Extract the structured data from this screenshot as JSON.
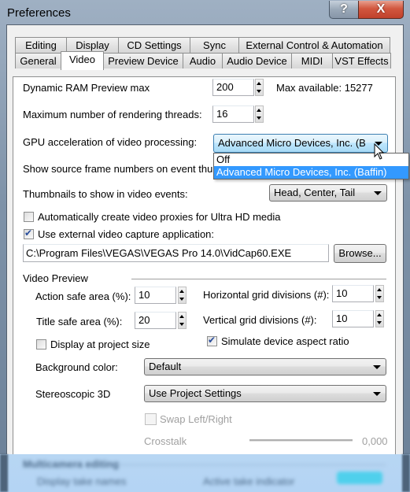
{
  "window": {
    "title": "Preferences",
    "help_label": "?",
    "close_label": "X"
  },
  "tabs": {
    "row_top": [
      {
        "label": "Editing"
      },
      {
        "label": "Display"
      },
      {
        "label": "CD Settings"
      },
      {
        "label": "Sync"
      },
      {
        "label": "External Control & Automation"
      }
    ],
    "row_bottom": [
      {
        "label": "General"
      },
      {
        "label": "Video",
        "active": true
      },
      {
        "label": "Preview Device"
      },
      {
        "label": "Audio"
      },
      {
        "label": "Audio Device"
      },
      {
        "label": "MIDI"
      },
      {
        "label": "VST Effects"
      }
    ]
  },
  "video": {
    "ram_preview": {
      "label": "Dynamic RAM Preview max",
      "value": "200",
      "max_label": "Max available: 15277"
    },
    "render_threads": {
      "label": "Maximum number of rendering threads:",
      "value": "16"
    },
    "gpu": {
      "label": "GPU acceleration of video processing:",
      "value": "Advanced Micro Devices, Inc. (B",
      "options": [
        "Off",
        "Advanced Micro Devices, Inc. (Baffin)"
      ],
      "highlighted_option": "Advanced Micro Devices, Inc. (Baffin)"
    },
    "show_frame_numbers": {
      "label": "Show source frame numbers on event thu"
    },
    "thumbnails": {
      "label": "Thumbnails to show in video events:",
      "value": "Head, Center, Tail"
    },
    "auto_proxies": {
      "label": "Automatically create video proxies for Ultra HD media",
      "checked": false
    },
    "external_capture": {
      "label": "Use external video capture application:",
      "checked": true
    },
    "capture_path": {
      "value": "C:\\Program Files\\VEGAS\\VEGAS Pro 14.0\\VidCap60.EXE"
    },
    "browse_label": "Browse..."
  },
  "video_preview": {
    "group_label": "Video Preview",
    "action_safe": {
      "label": "Action safe area (%):",
      "value": "10"
    },
    "title_safe": {
      "label": "Title safe area (%):",
      "value": "20"
    },
    "h_grid": {
      "label": "Horizontal grid divisions (#):",
      "value": "10"
    },
    "v_grid": {
      "label": "Vertical grid divisions (#):",
      "value": "10"
    },
    "display_project_size": {
      "label": "Display at project size",
      "checked": false
    },
    "simulate_aspect": {
      "label": "Simulate device aspect ratio",
      "checked": true
    },
    "background_color": {
      "label": "Background color:",
      "value": "Default"
    },
    "stereoscopic": {
      "label": "Stereoscopic 3D",
      "value": "Use Project Settings"
    },
    "swap_lr": {
      "label": "Swap Left/Right",
      "checked": false,
      "disabled": true
    },
    "crosstalk": {
      "label": "Crosstalk",
      "value": "0,000",
      "disabled": true
    }
  },
  "blurred_section": {
    "group_label": "Multicamera editing",
    "display_take_names": "Display take names",
    "active_take_indicator": "Active take indicator"
  },
  "colors": {
    "selection": "#3399ff",
    "close_button": "#c8462f",
    "focus_border": "#3c7fb1"
  }
}
